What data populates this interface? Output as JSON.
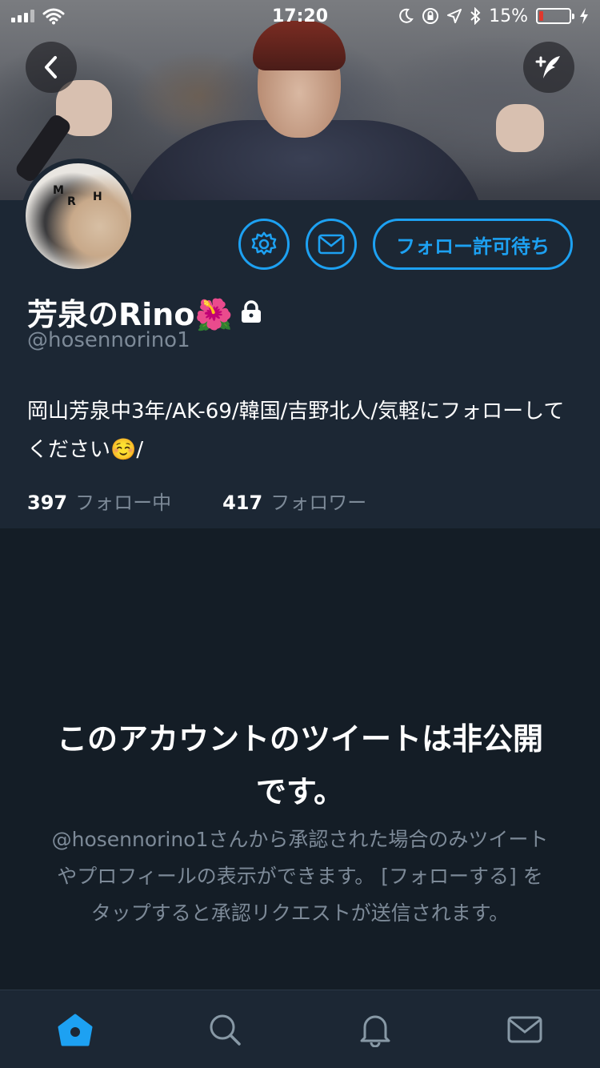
{
  "status_bar": {
    "time": "17:20",
    "battery_percent": 15,
    "battery_text": "15%",
    "battery_color": "#e0382d"
  },
  "banner": {
    "back_icon": "chevron-left-icon",
    "compose_icon": "compose-tweet-icon"
  },
  "profile": {
    "avatar_letters": [
      "M",
      "R",
      "H"
    ],
    "display_name": "芳泉のRino🌺",
    "handle": "@hosennorino1",
    "bio": "岡山芳泉中3年/AK-69/韓国/吉野北人/気軽にフォローしてください☺️/",
    "following_count": "397",
    "following_label": "フォロー中",
    "followers_count": "417",
    "followers_label": "フォロワー",
    "settings_icon": "gear-icon",
    "message_icon": "envelope-icon",
    "follow_pending_label": "フォロー許可待ち",
    "accent_color": "#1da1f2"
  },
  "private_notice": {
    "title": "このアカウントのツイートは非公開です。",
    "description": "@hosennorino1さんから承認された場合のみツイートやプロフィールの表示ができます。 [フォローする] をタップすると承認リクエストが送信されます。"
  },
  "tab_bar": {
    "tabs": [
      {
        "name": "home",
        "icon": "home-icon",
        "active": true
      },
      {
        "name": "search",
        "icon": "search-icon",
        "active": false
      },
      {
        "name": "notifications",
        "icon": "bell-icon",
        "active": false
      },
      {
        "name": "messages",
        "icon": "envelope-icon",
        "active": false
      }
    ]
  }
}
